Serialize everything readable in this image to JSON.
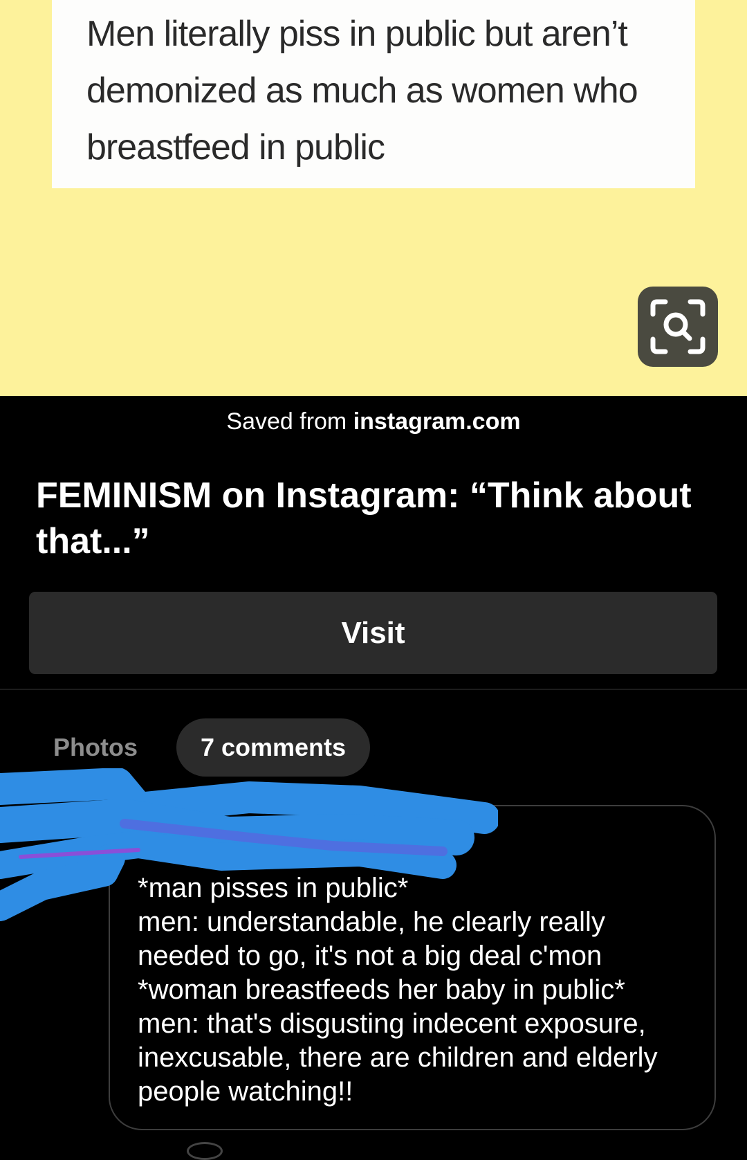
{
  "pin": {
    "quote": "Men literally piss in public but aren’t demonized as much as women who breastfeed in public",
    "background_color": "#fdf29b",
    "lens_icon": "visual-search-icon"
  },
  "saved_from": {
    "prefix": "Saved from",
    "domain": "instagram.com"
  },
  "title": "FEMINISM on Instagram: “Think about that...”",
  "visit_label": "Visit",
  "tabs": [
    {
      "label": "Photos",
      "active": false
    },
    {
      "label": "7 comments",
      "active": true
    }
  ],
  "comment": {
    "author_redacted": true,
    "redaction_color": "#2f8de4",
    "text": "*man pisses in public*\nmen: understandable, he clearly really needed to go, it's not a big deal c'mon\n*woman breastfeeds her baby in public*\nmen: that's disgusting indecent exposure, inexcusable, there are children and elderly people watching!!"
  }
}
